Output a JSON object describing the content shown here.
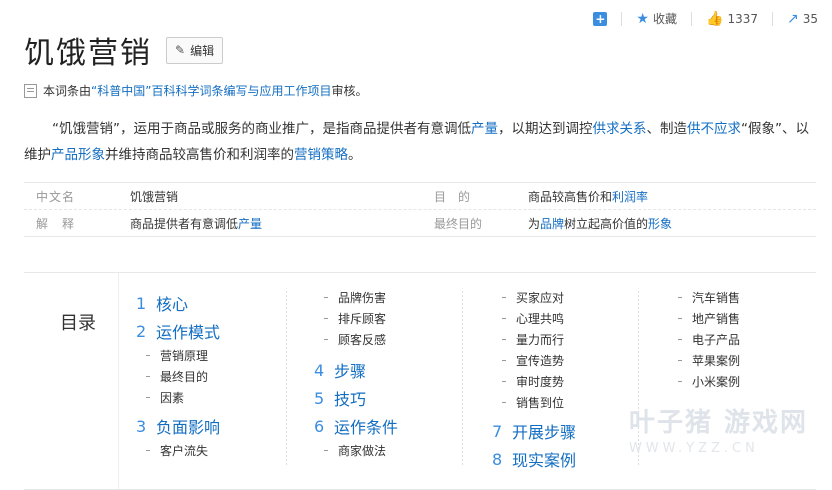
{
  "toolbar": {
    "collect_label": "收藏",
    "like_count": "1337",
    "share_count": "35"
  },
  "header": {
    "title": "饥饿营销",
    "edit_label": "编辑"
  },
  "audit": {
    "prefix": "本词条由",
    "link": "“科普中国”百科科学词条编写与应用工作项目",
    "suffix": " 审核。"
  },
  "summary": {
    "p1": "“饥饿营销”，运用于商品或服务的商业推广，是指商品提供者有意调低",
    "l1": "产量",
    "p2": "，以期达到调控",
    "l2": "供求关系",
    "p3": "、制造",
    "l3": "供不应求",
    "p4": "“假象”、以维护",
    "l4": "产品形象",
    "p5": "并维持商品较高售价和利润率的",
    "l5": "营销策略",
    "p6": "。"
  },
  "info": {
    "r1": {
      "label": "中文名",
      "value": "饥饿营销",
      "label2": "目　的",
      "value2_text": "商品较高售价和",
      "value2_link": "利润率"
    },
    "r2": {
      "label": "解　释",
      "value_text": "商品提供者有意调低",
      "value_link": "产量",
      "label2": "最终目的",
      "value2_pre": "为",
      "value2_link": "品牌",
      "value2_mid": "树立起高价值的",
      "value2_link2": "形象"
    }
  },
  "toc": {
    "label": "目录",
    "c1_s1_num": "1",
    "c1_s1": "核心",
    "c1_s2_num": "2",
    "c1_s2": "运作模式",
    "c1_s2_items": [
      "营销原理",
      "最终目的",
      "因素"
    ],
    "c1_s3_num": "3",
    "c1_s3": "负面影响",
    "c1_s3_items": [
      "客户流失"
    ],
    "c2_items": [
      "品牌伤害",
      "排斥顾客",
      "顾客反感"
    ],
    "c2_s4_num": "4",
    "c2_s4": "步骤",
    "c2_s5_num": "5",
    "c2_s5": "技巧",
    "c2_s6_num": "6",
    "c2_s6": "运作条件",
    "c2_s6_items": [
      "商家做法"
    ],
    "c3_items": [
      "买家应对",
      "心理共鸣",
      "量力而行",
      "宣传造势",
      "审时度势",
      "销售到位"
    ],
    "c3_s7_num": "7",
    "c3_s7": "开展步骤",
    "c3_s8_num": "8",
    "c3_s8": "现实案例",
    "c4_items": [
      "汽车销售",
      "地产销售",
      "电子产品",
      "苹果案例",
      "小米案例"
    ]
  },
  "watermark": {
    "main": "叶子猪 游戏网",
    "url": "WWW.YZZ.CN"
  }
}
